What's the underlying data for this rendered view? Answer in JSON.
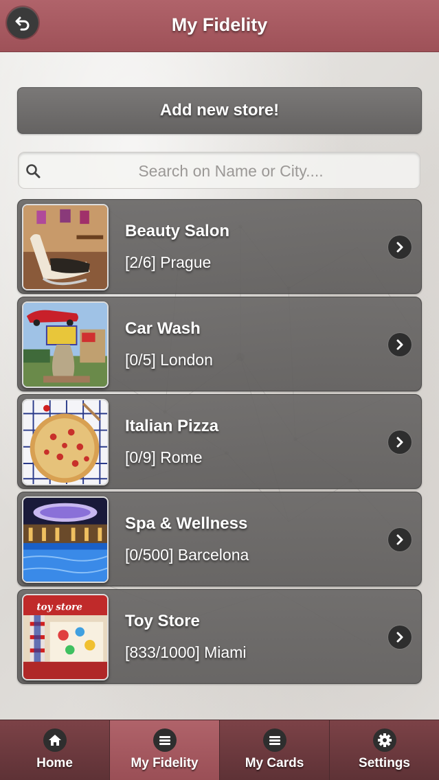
{
  "header": {
    "title": "My Fidelity"
  },
  "add_button": {
    "label": "Add new store!"
  },
  "search": {
    "placeholder": "Search on Name or City...."
  },
  "stores": [
    {
      "name": "Beauty Salon",
      "subtitle": "[2/6] Prague"
    },
    {
      "name": "Car Wash",
      "subtitle": "[0/5] London"
    },
    {
      "name": "Italian Pizza",
      "subtitle": "[0/9] Rome"
    },
    {
      "name": "Spa & Wellness",
      "subtitle": "[0/500] Barcelona"
    },
    {
      "name": "Toy Store",
      "subtitle": "[833/1000] Miami"
    }
  ],
  "tabs": [
    {
      "label": "Home",
      "icon": "home-icon"
    },
    {
      "label": "My Fidelity",
      "icon": "menu-icon"
    },
    {
      "label": "My Cards",
      "icon": "menu-icon"
    },
    {
      "label": "Settings",
      "icon": "gear-icon"
    }
  ],
  "colors": {
    "header": "#a85a61",
    "active_tab": "#a85a61",
    "tab": "#6e3a3e",
    "list_item": "#646261"
  }
}
